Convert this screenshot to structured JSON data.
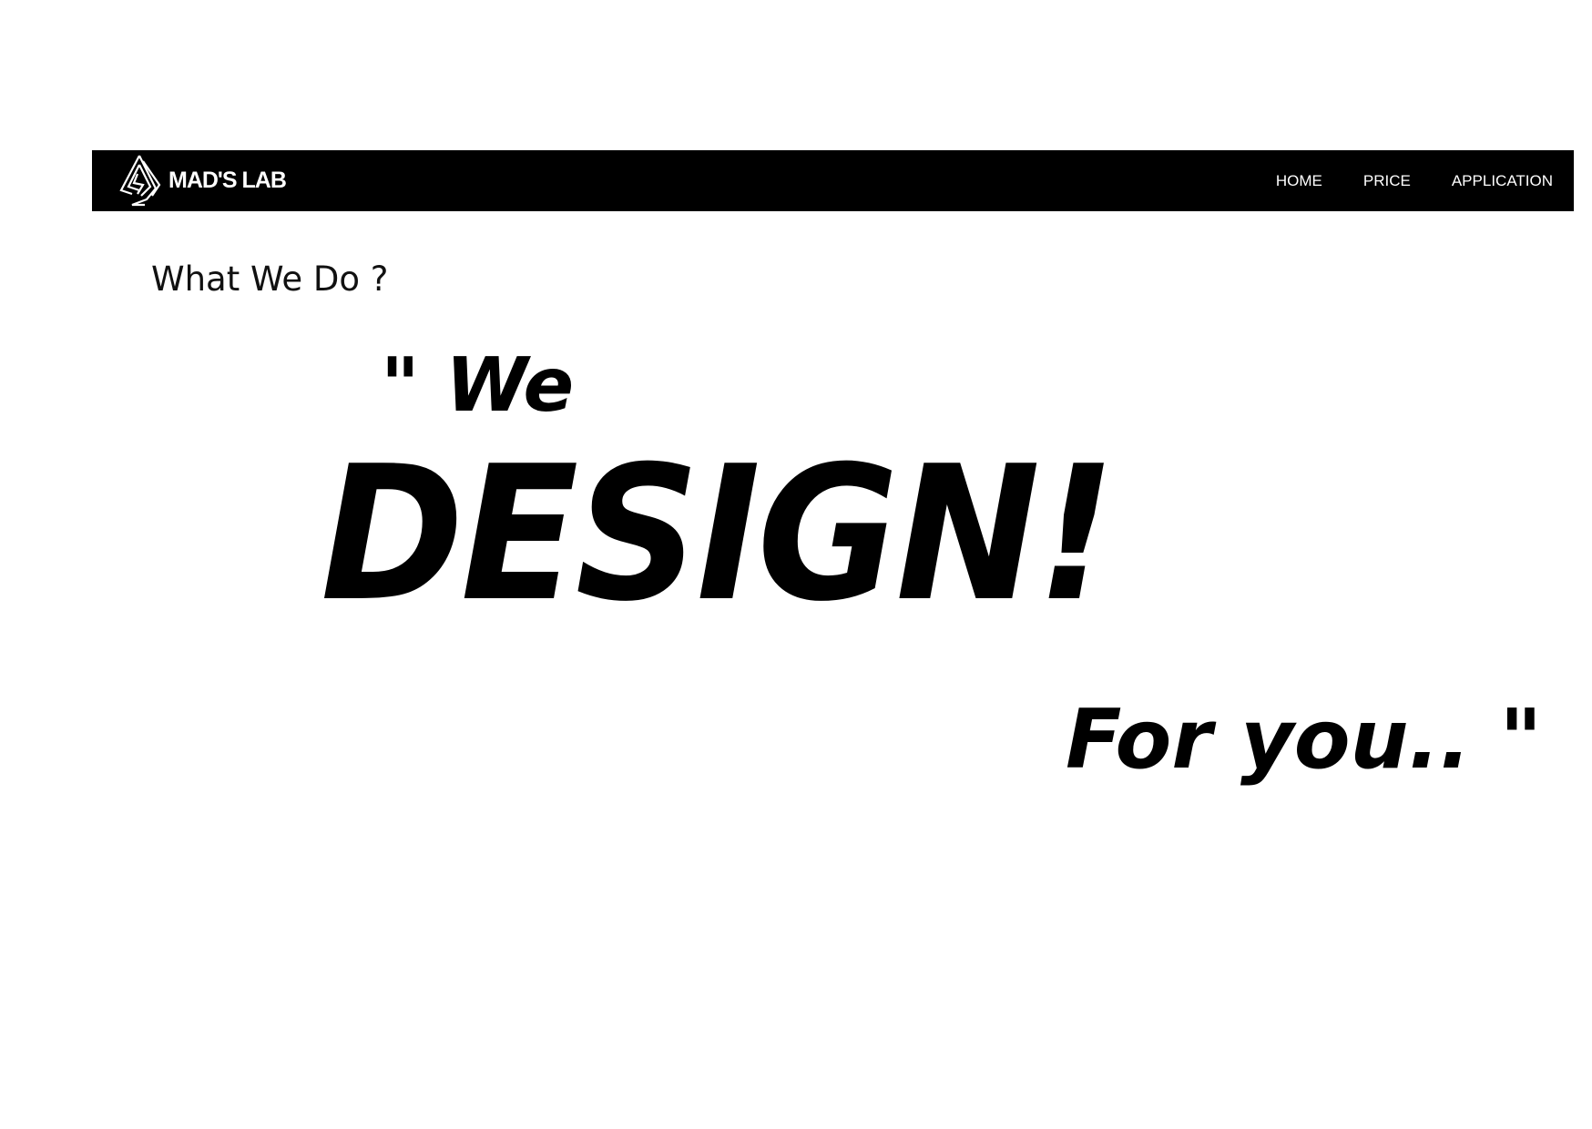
{
  "navbar": {
    "brand_name": "MAD'S LAB",
    "logo_icon": "triangle-logo-icon",
    "links": [
      {
        "label": "HOME"
      },
      {
        "label": "PRICE"
      },
      {
        "label": "APPLICATION"
      }
    ]
  },
  "section": {
    "heading": "What We Do ?"
  },
  "hero": {
    "line1": "\" We",
    "line2": "DESIGN!",
    "line3": "For you.. \""
  },
  "colors": {
    "navbar_bg": "#000000",
    "navbar_text": "#ffffff",
    "page_bg": "#ffffff",
    "text": "#000000"
  }
}
